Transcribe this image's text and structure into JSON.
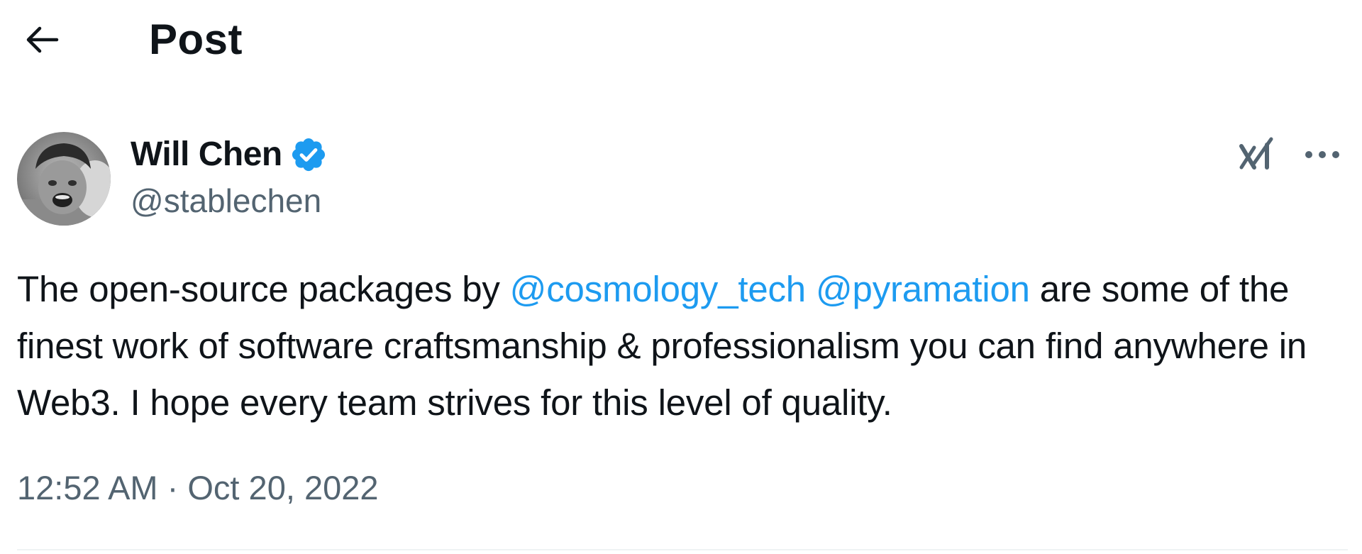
{
  "header": {
    "back_icon": "arrow-left-icon",
    "title": "Post"
  },
  "author": {
    "name": "Will Chen",
    "handle": "@stablechen",
    "verified": true,
    "verified_color": "#1d9bf0",
    "avatar_style": "grayscale photo"
  },
  "actions": {
    "grok_icon": "grok-icon",
    "more_icon": "more-horizontal-icon"
  },
  "post": {
    "text_before": "The open-source packages by ",
    "mention_1": "@cosmology_tech",
    "text_between": " ",
    "mention_2": "@pyramation",
    "text_after": " are some of the finest work of software craftsmanship & professionalism you can find anywhere in Web3. I hope every team strives for this level of quality."
  },
  "meta": {
    "time": "12:52 AM",
    "separator": " · ",
    "date": "Oct 20, 2022"
  },
  "colors": {
    "text": "#0f1419",
    "secondary": "#536471",
    "link": "#1d9bf0",
    "divider": "#eff3f4"
  }
}
